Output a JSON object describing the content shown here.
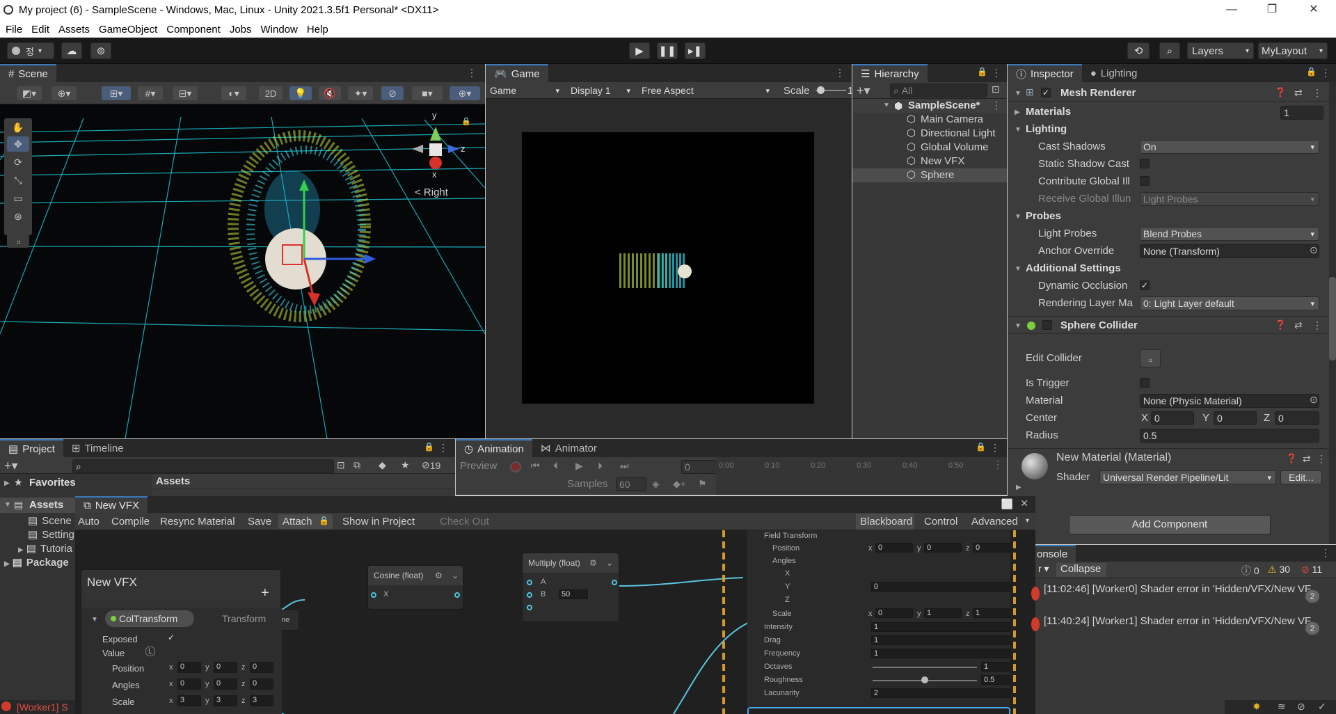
{
  "window": {
    "title": "My project (6) - SampleScene - Windows, Mac, Linux - Unity 2021.3.5f1 Personal* <DX11>",
    "minimize": "—",
    "restore": "❐",
    "close": "✕"
  },
  "menu": [
    "File",
    "Edit",
    "Assets",
    "GameObject",
    "Component",
    "Jobs",
    "Window",
    "Help"
  ],
  "toolbar": {
    "account": "정",
    "layers": "Layers",
    "layout": "MyLayout"
  },
  "scene": {
    "tab": "Scene",
    "mode_2d": "2D",
    "gizmo_y": "y",
    "gizmo_z": "z",
    "gizmo_x": "x",
    "gizmo_label": "< Right"
  },
  "game": {
    "tab": "Game",
    "mode": "Game",
    "display": "Display 1",
    "aspect": "Free Aspect",
    "scale_label": "Scale",
    "scale_val": "1"
  },
  "hierarchy": {
    "tab": "Hierarchy",
    "search_placeholder": "All",
    "scene_name": "SampleScene*",
    "items": [
      "Main Camera",
      "Directional Light",
      "Global Volume",
      "New VFX",
      "Sphere"
    ],
    "selected": "Sphere"
  },
  "inspector": {
    "tab": "Inspector",
    "tab2": "Lighting",
    "mesh_renderer": "Mesh Renderer",
    "materials": "Materials",
    "materials_count": "1",
    "lighting": "Lighting",
    "cast_shadows": "Cast Shadows",
    "cast_shadows_val": "On",
    "static_shadow": "Static Shadow Cast",
    "contribute_gi": "Contribute Global Ill",
    "receive_gi": "Receive Global Illun",
    "receive_gi_val": "Light Probes",
    "probes": "Probes",
    "light_probes": "Light Probes",
    "light_probes_val": "Blend Probes",
    "anchor": "Anchor Override",
    "anchor_val": "None (Transform)",
    "additional": "Additional Settings",
    "dyn_occ": "Dynamic Occlusion",
    "rend_layer": "Rendering Layer Ma",
    "rend_layer_val": "0: Light Layer default",
    "sphere_collider": "Sphere Collider",
    "edit_collider": "Edit Collider",
    "is_trigger": "Is Trigger",
    "material": "Material",
    "material_val": "None (Physic Material)",
    "center": "Center",
    "cx": "X",
    "cx_val": "0",
    "cy": "Y",
    "cy_val": "0",
    "cz": "Z",
    "cz_val": "0",
    "radius": "Radius",
    "radius_val": "0.5",
    "mat_name": "New Material (Material)",
    "shader": "Shader",
    "shader_val": "Universal Render Pipeline/Lit",
    "edit_btn": "Edit...",
    "add_component": "Add Component"
  },
  "project": {
    "tab": "Project",
    "tab2": "Timeline",
    "favorites": "Favorites",
    "assets_header": "Assets",
    "hidden_count": "19",
    "tree": [
      "Assets",
      "Scene",
      "Setting",
      "Tutoria",
      "Package"
    ]
  },
  "animation": {
    "tab": "Animation",
    "tab2": "Animator",
    "preview": "Preview",
    "frame": "0",
    "samples": "Samples",
    "samples_val": "60",
    "ticks": [
      "0:00",
      "0:10",
      "0:20",
      "0:30",
      "0:40",
      "0:50"
    ]
  },
  "vfx": {
    "tab": "New VFX",
    "auto": "Auto",
    "compile": "Compile",
    "resync": "Resync Material",
    "save": "Save",
    "attach": "Attach",
    "show": "Show in Project",
    "checkout": "Check Out",
    "blackboard": "Blackboard",
    "control": "Control",
    "advanced": "Advanced",
    "bb_title": "New VFX",
    "bb_prop": "ColTransform",
    "bb_type": "Transform",
    "exposed": "Exposed",
    "value": "Value",
    "position": "Position",
    "angles": "Angles",
    "scale": "Scale",
    "cosine": "Cosine (float)",
    "cos_x": "X",
    "multiply": "Multiply (float)",
    "mul_a": "A",
    "mul_b": "B",
    "mul_b_val": "50",
    "name_frag": "me",
    "field_transform": "Field Transform",
    "f_position": "Position",
    "f_angles": "Angles",
    "f_x": "X",
    "f_y": "Y",
    "f_z": "Z",
    "f_y_val": "0",
    "f_scale": "Scale",
    "intensity": "Intensity",
    "intensity_val": "1",
    "drag": "Drag",
    "drag_val": "1",
    "frequency": "Frequency",
    "frequency_val": "1",
    "octaves": "Octaves",
    "octaves_val": "1",
    "roughness": "Roughness",
    "roughness_val": "0.5",
    "lacunarity": "Lacunarity",
    "lacunarity_val": "2",
    "zero": "0",
    "one": "1",
    "three": "3",
    "ax": "x",
    "ay": "y",
    "az": "z",
    "chevron": "⌄",
    "plus": "+",
    "settings_glyph": "⚙",
    "lock_glyph": "🔒",
    "gear": "⚙",
    "menu_glyph": "⋮"
  },
  "console": {
    "tab": "onsole",
    "collapse": "Collapse",
    "info_count": "0",
    "warn_count": "30",
    "err_count": "11",
    "rows": [
      {
        "text": "[11:02:46] [Worker0] Shader error in 'Hidden/VFX/New VF",
        "count": "2"
      },
      {
        "text": "[11:40:24] [Worker1] Shader error in 'Hidden/VFX/New VF",
        "count": "2"
      }
    ]
  },
  "status": {
    "text": "[Worker1] S"
  }
}
